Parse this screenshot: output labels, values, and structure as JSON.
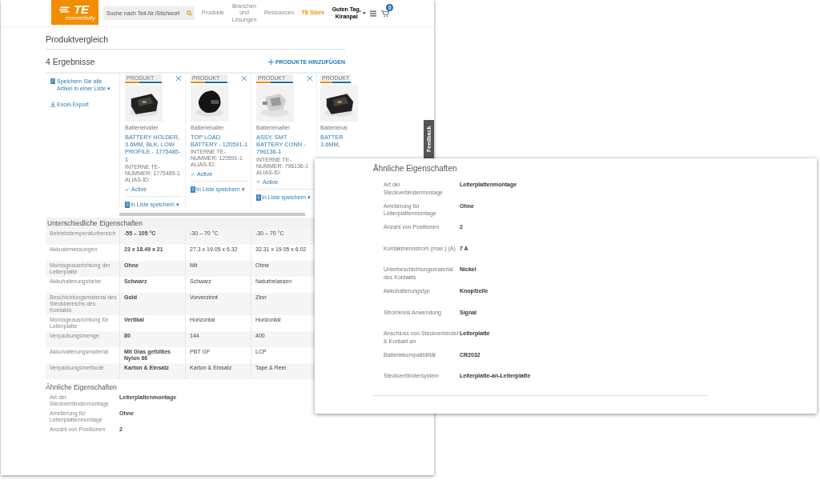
{
  "header": {
    "logo_mark": "TE",
    "logo_subtext": "connectivity",
    "search": {
      "placeholder": "Suche nach Teil-Nr./Stichwort"
    },
    "nav": [
      {
        "label": "Produkte",
        "selected": false
      },
      {
        "label": "Branchen und Lösungen",
        "selected": false
      },
      {
        "label": "Ressourcen",
        "selected": false
      },
      {
        "label": "TE Store",
        "selected": true
      }
    ],
    "greeting": "Guten Tag, Kiranpal",
    "cart_count": "0"
  },
  "page_title": "Produktvergleich",
  "results_count": "4 Ergebnisse",
  "add_products": "PRODUKTE HINZUFÜGEN",
  "sidebar_actions": [
    {
      "kind": "list",
      "label": "Speichern Sie alle Artikel in einer Liste ▾"
    },
    {
      "kind": "download",
      "label": "Excel-Export"
    }
  ],
  "products": [
    {
      "tag": "PRODUKT",
      "removable": true,
      "category": "Batteriehalter",
      "title": "BATTERY HOLDER, 3.6MM, BLK, LOW PROFILE - 1775485-1",
      "part_number": "INTERNE TE-NUMMER: 1775485-1",
      "alias": "ALIAS-ID:",
      "status": "Active",
      "save": "In Liste speichern ▾"
    },
    {
      "tag": "PRODUKT",
      "removable": true,
      "category": "Batteriehalter",
      "title": "TOP LOAD BATTERY - 120591-1",
      "part_number": "INTERNE TE-NUMMER: 120591-1",
      "alias": "ALIAS-ID:",
      "status": "Active",
      "save": "In Liste speichern ▾"
    },
    {
      "tag": "PRODUKT",
      "removable": true,
      "category": "Batteriehalter",
      "title": "ASSY, SMT BATTERY CONN - 796136-1",
      "part_number": "INTERNE TE-NUMMER: 796136-1",
      "alias": "ALIAS-ID:",
      "status": "Active",
      "save": "In Liste speichern ▾"
    },
    {
      "tag": "PRODUKT",
      "removable": false,
      "category": "Batteriehal",
      "title": "BATTER 3.6MM,"
    }
  ],
  "different_properties": {
    "title": "Unterschiedliche Eigenschaften",
    "rows": [
      {
        "label": "Betriebstemperaturbereich",
        "values": [
          "-55 – 105 °C",
          "-30 – 70 °C",
          "-30 – 70 °C"
        ]
      },
      {
        "label": "Akkuabmessungen",
        "values": [
          "23 x 18.49 x 21",
          "27.3 x 19.05 x 6.32",
          "32.31 x 19.05 x 6.02"
        ]
      },
      {
        "label": "Montageausrichtung der Leiterplatte",
        "values": [
          "Ohne",
          "Mit",
          "Ohne"
        ]
      },
      {
        "label": "Akkuhalterungsfarbe",
        "values": [
          "Schwarz",
          "Schwarz",
          "Naturbelassen"
        ]
      },
      {
        "label": "Beschichtungsmaterial des Steckbereichs des Kontakts",
        "values": [
          "Gold",
          "Vorverzinnt",
          "Zinn"
        ]
      },
      {
        "label": "Montageausrichtung für Leiterplatte",
        "values": [
          "Vertikal",
          "Horizontal",
          "Horizontal"
        ]
      },
      {
        "label": "Verpackungsmenge",
        "values": [
          "80",
          "144",
          "400"
        ]
      },
      {
        "label": "Akkuhalterungsmaterial",
        "values": [
          "Mit Glas gefülltes Nylon 66",
          "PBT GF",
          "LCP"
        ]
      },
      {
        "label": "Verpackungsmethode",
        "values": [
          "Karton & Einsatz",
          "Karton & Einsatz",
          "Tape & Reel"
        ]
      }
    ]
  },
  "similar_properties": {
    "title": "Ähnliche Eigenschaften",
    "rows": [
      {
        "label": "Art der Steckverbindermontage",
        "value": "Leiterplattenmontage"
      },
      {
        "label": "Arretierung für Leiterplattenmontage",
        "value": "Ohne"
      },
      {
        "label": "Anzahl von Positionen",
        "value": "2"
      }
    ]
  },
  "feedback_tab": "Feedback",
  "zoomed_panel": {
    "title": "Ähnliche Eigenschaften",
    "rows": [
      {
        "label": "Art der Steckverbindermontage",
        "value": "Leiterplattenmontage"
      },
      {
        "label": "Arretierung für Leiterplattenmontage",
        "value": "Ohne"
      },
      {
        "label": "Anzahl von Positionen",
        "value": "2"
      },
      {
        "label": "Kontaktnennstrom (max.) (A)",
        "value": "7 A"
      },
      {
        "label": "Unterbeschichtungsmaterial des Kontakts",
        "value": "Nickel"
      },
      {
        "label": "Akkuhalterungstyp",
        "value": "Knopfzelle"
      },
      {
        "label": "Stromkreis Anwendung",
        "value": "Signal"
      },
      {
        "label": "Anschluss von Steckverbinder & Kontakt an",
        "value": "Leiterplatte"
      },
      {
        "label": "Batteriekompatibilität",
        "value": "CR2032"
      },
      {
        "label": "Steckverbindersystem",
        "value": "Leiterplatte-an-Leiterplatte"
      }
    ]
  }
}
